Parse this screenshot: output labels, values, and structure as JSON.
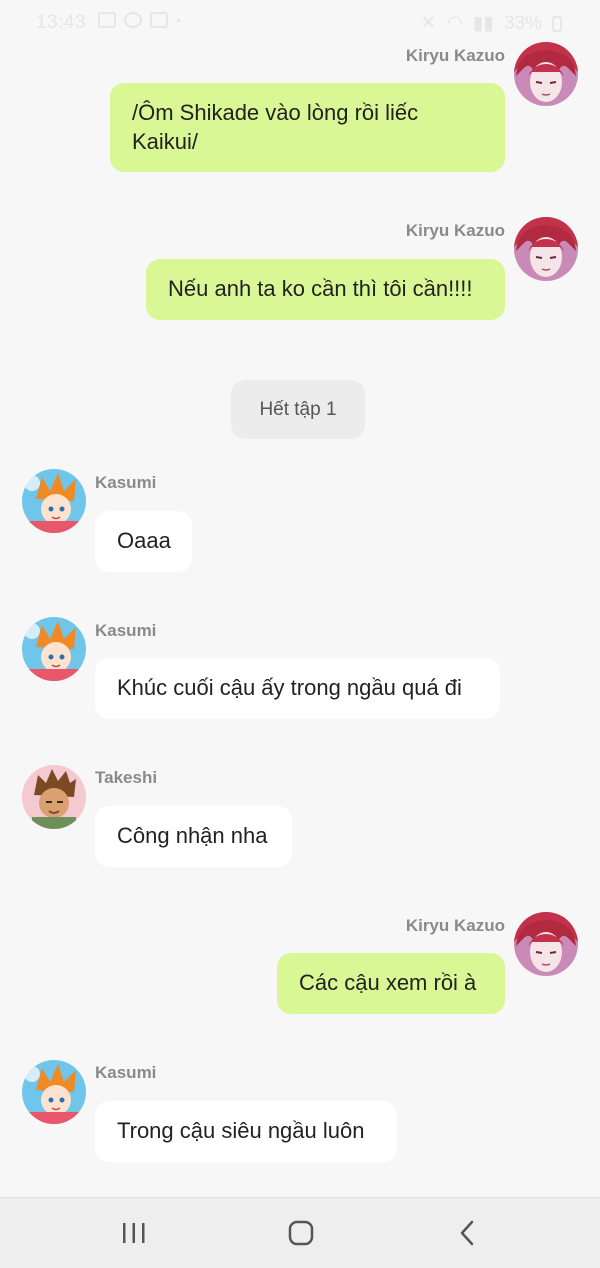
{
  "status_bar": {
    "time": "13:43",
    "battery": "33%"
  },
  "messages": [
    {
      "sender": "Kiryu Kazuo",
      "side": "mine",
      "lines": [
        "/Ôm Shikade vào lòng rồi liếc",
        "Kaikui/"
      ]
    },
    {
      "sender": "Kiryu Kazuo",
      "side": "mine",
      "lines": [
        "Nếu anh ta ko cần thì tôi cần!!!!"
      ]
    },
    {
      "sender": "Kasumi",
      "side": "theirs",
      "lines": [
        "Oaaa"
      ]
    },
    {
      "sender": "Kasumi",
      "side": "theirs",
      "lines": [
        "Khúc cuối cậu ấy trong ngầu quá đi"
      ]
    },
    {
      "sender": "Takeshi",
      "side": "theirs",
      "lines": [
        "Công nhận nha"
      ]
    },
    {
      "sender": "Kiryu Kazuo",
      "side": "mine",
      "lines": [
        "Các cậu xem rồi à"
      ]
    },
    {
      "sender": "Kasumi",
      "side": "theirs",
      "lines": [
        "Trong cậu siêu ngầu luôn"
      ]
    }
  ],
  "system_message": "Hết tập 1",
  "nav_bar": {
    "icons": [
      "recent-apps-icon",
      "home-icon",
      "back-icon"
    ]
  },
  "colors": {
    "mine_bubble": "#d9f795",
    "their_bubble": "#ffffff",
    "background": "#f7f7f7"
  }
}
